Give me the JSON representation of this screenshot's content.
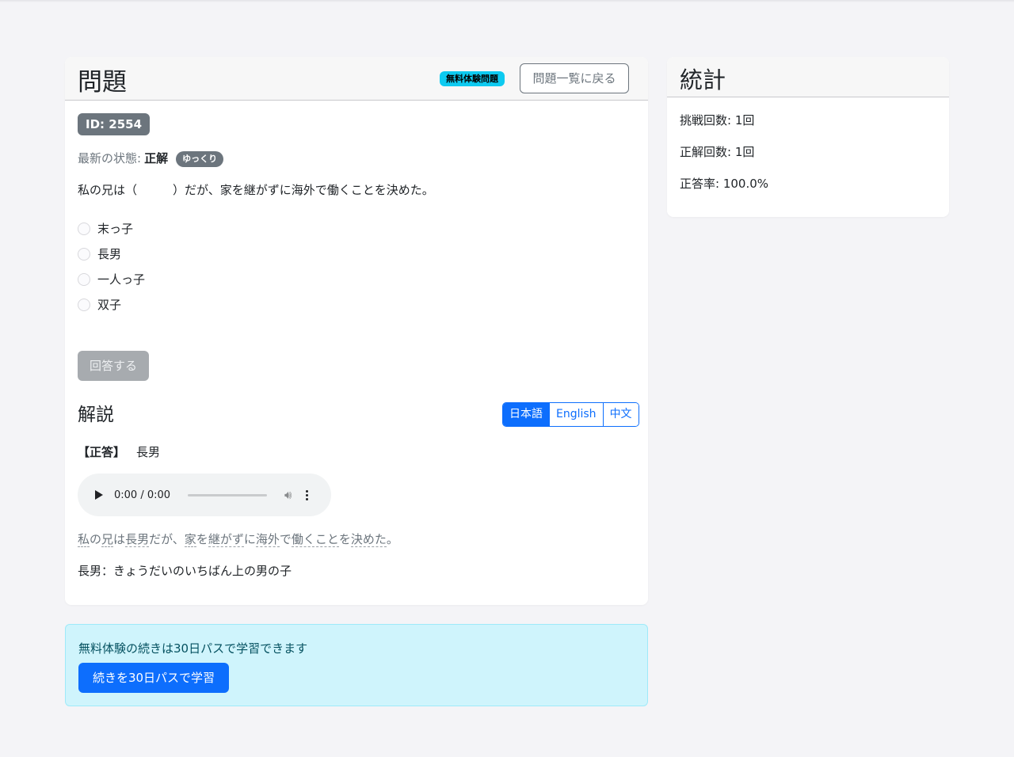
{
  "question_card": {
    "title": "問題",
    "free_badge": "無料体験問題",
    "back_button": "問題一覧に戻る",
    "id_badge": "ID: 2554",
    "status_label": "最新の状態:",
    "status_value": "正解",
    "speed_badge": "ゆっくり",
    "question_text": "私の兄は（　　　）だが、家を継がずに海外で働くことを決めた。",
    "choices": [
      "末っ子",
      "長男",
      "一人っ子",
      "双子"
    ],
    "answer_button": "回答する"
  },
  "explanation": {
    "title": "解説",
    "languages": [
      "日本語",
      "English",
      "中文"
    ],
    "active_language": "日本語",
    "correct_label": "【正答】",
    "correct_value": "長男",
    "audio_time": "0:00 / 0:00",
    "sentence_parts": [
      "私",
      "の",
      "兄",
      "は",
      "長男",
      "だが、",
      "家",
      "を",
      "継がず",
      "に",
      "海外",
      "で",
      "働くこと",
      "を",
      "決めた",
      "。"
    ],
    "definition": "長男：きょうだいのいちばん上の男の子"
  },
  "stats": {
    "title": "統計",
    "attempts": "挑戦回数: 1回",
    "correct_count": "正解回数: 1回",
    "accuracy": "正答率: 100.0%"
  },
  "promo": {
    "text": "無料体験の続きは30日パスで学習できます",
    "button": "続きを30日パスで学習"
  },
  "icons": {
    "audio_play": "play-icon",
    "audio_volume": "volume-icon",
    "audio_more": "more-vertical-icon"
  },
  "colors": {
    "primary": "#0d6efd",
    "info": "#0dcaf0",
    "secondary": "#6c757d",
    "alert_bg": "#cff4fc"
  }
}
